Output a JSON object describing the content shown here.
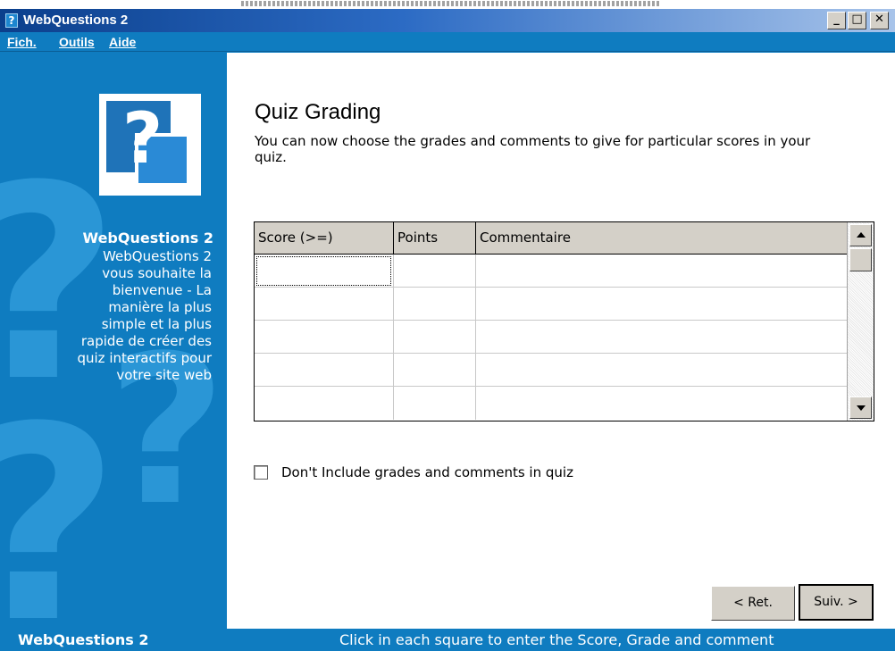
{
  "window": {
    "title": "WebQuestions 2",
    "icon": "question-mark-icon",
    "controls": {
      "minimize": "minimize-icon",
      "maximize": "maximize-icon",
      "close": "close-icon"
    }
  },
  "menu": {
    "items": [
      {
        "label": "Fich."
      },
      {
        "label": "Outils"
      },
      {
        "label": "Aide"
      }
    ]
  },
  "sidebar": {
    "heading": "WebQuestions 2",
    "description": "WebQuestions 2\nvous souhaite la\nbienvenue - La\nmanière la plus\nsimple et la plus\nrapide de créer des\nquiz interactifs pour\nvotre site web",
    "logo_glyph": "?"
  },
  "main": {
    "title": "Quiz Grading",
    "subtitle": "You can now choose the grades and comments to give for particular scores in your quiz.",
    "grid": {
      "columns": [
        "Score (>=)",
        "Points",
        "Commentaire"
      ],
      "rows": [
        [
          "",
          "",
          ""
        ],
        [
          "",
          "",
          ""
        ],
        [
          "",
          "",
          ""
        ],
        [
          "",
          "",
          ""
        ],
        [
          "",
          "",
          ""
        ]
      ]
    },
    "checkbox": {
      "label": "Don't Include grades and comments in quiz",
      "checked": false
    },
    "buttons": {
      "back": "< Ret.",
      "next": "Suiv. >"
    }
  },
  "status": {
    "left": "WebQuestions 2",
    "right": "Click in each square to enter the Score, Grade and comment"
  },
  "colors": {
    "brand_blue": "#0f7cc0",
    "titlebar_dark": "#0b3f8c",
    "button_face": "#d4d0c8"
  }
}
